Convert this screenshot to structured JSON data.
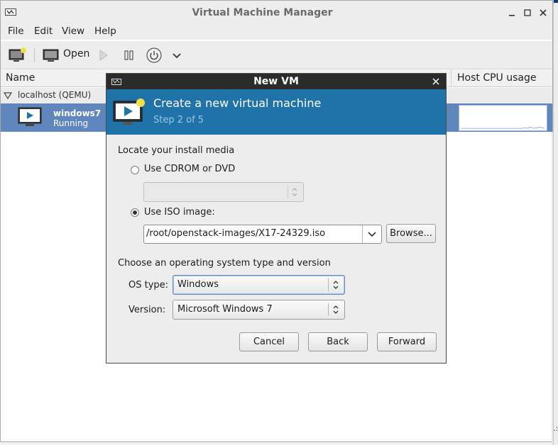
{
  "window": {
    "title": "Virtual Machine Manager"
  },
  "menubar": {
    "file": "File",
    "edit": "Edit",
    "view": "View",
    "help": "Help"
  },
  "toolbar": {
    "open_label": "Open"
  },
  "list": {
    "col_name": "Name",
    "col_cpu": "Host CPU usage",
    "group": "localhost (QEMU)",
    "vm": {
      "name": "windows7",
      "status": "Running"
    }
  },
  "dialog": {
    "title": "New VM",
    "heading": "Create a new virtual machine",
    "step": "Step 2 of 5",
    "locate_label": "Locate your install media",
    "cdrom_label": "Use CDROM or DVD",
    "iso_label": "Use ISO image:",
    "iso_value": "/root/openstack-images/X17-24329.iso",
    "browse_label": "Browse...",
    "os_section_label": "Choose an operating system type and version",
    "os_type_label": "OS type:",
    "os_type_value": "Windows",
    "version_label": "Version:",
    "version_value": "Microsoft Windows 7",
    "cancel_label": "Cancel",
    "back_label": "Back",
    "forward_label": "Forward",
    "selected_media": "iso"
  },
  "colors": {
    "banner": "#1f73a8",
    "selection": "#5f86bd",
    "dialog_titlebar": "#2b2b2b"
  }
}
